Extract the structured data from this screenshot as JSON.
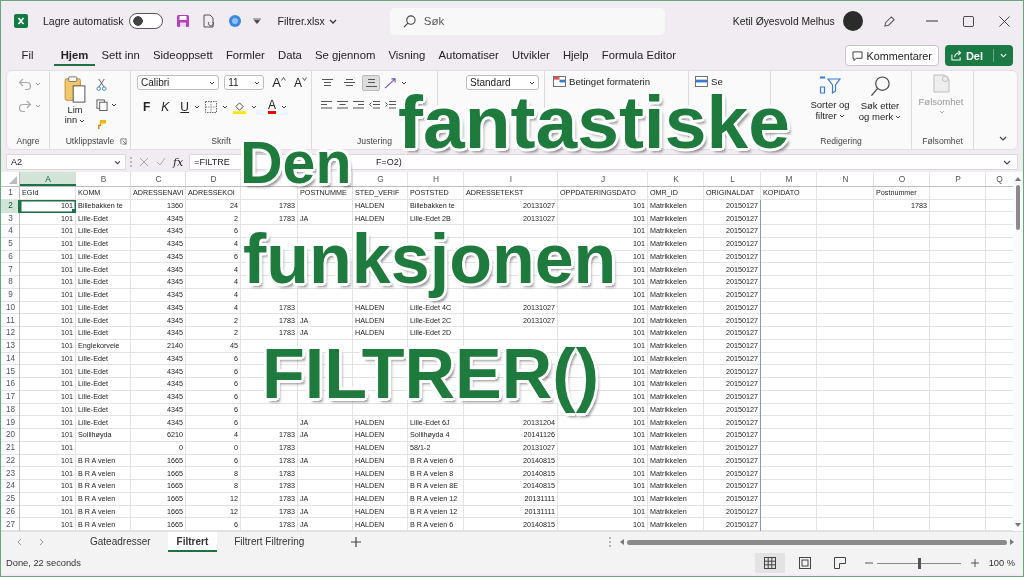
{
  "title_bar": {
    "autosave": {
      "label": "Lagre automatisk",
      "on": false
    },
    "file_name": "Filtrer.xlsx",
    "search": {
      "placeholder": "Søk"
    },
    "user_name": "Ketil Øyesvold Melhus"
  },
  "menu_tabs": [
    {
      "label": "Fil",
      "selected": false
    },
    {
      "label": "Hjem",
      "selected": true
    },
    {
      "label": "Sett inn",
      "selected": false
    },
    {
      "label": "Sideoppsett",
      "selected": false
    },
    {
      "label": "Formler",
      "selected": false
    },
    {
      "label": "Data",
      "selected": false
    },
    {
      "label": "Se gjennom",
      "selected": false
    },
    {
      "label": "Visning",
      "selected": false
    },
    {
      "label": "Automatiser",
      "selected": false
    },
    {
      "label": "Utvikler",
      "selected": false
    },
    {
      "label": "Hjelp",
      "selected": false
    },
    {
      "label": "Formula Editor",
      "selected": false
    }
  ],
  "header_buttons": {
    "comments": "Kommentarer",
    "share": "Del"
  },
  "ribbon": {
    "history": {
      "label": "Angre",
      "undo_disabled": true,
      "redo_disabled": true
    },
    "clipboard": {
      "label": "Utklippstavle",
      "paste": "Lim inn"
    },
    "font": {
      "label": "Skrift",
      "font_name": "Calibri",
      "font_size": "11",
      "grow": "A",
      "shrink": "A",
      "bold": "F",
      "italic": "K",
      "underline": "U",
      "font_color": "A"
    },
    "alignment": {
      "label": "Justering",
      "vertical": [
        {
          "kind": "top",
          "selected": false
        },
        {
          "kind": "middle",
          "selected": false
        },
        {
          "kind": "bottom",
          "selected": true
        }
      ]
    },
    "number": {
      "format": "Standard"
    },
    "styles": {
      "conditional": "Betinget formaterin"
    },
    "cells": {
      "insert": "Se"
    },
    "editing": {
      "label": "Redigering",
      "sort": "Sorter og filtrer",
      "find": "Søk etter og merk"
    },
    "sensitivity": {
      "label": "Følsomhet",
      "button": "Følsomhet",
      "disabled": true
    }
  },
  "formula_bar": {
    "name_box": "A2",
    "fx": "fx",
    "formula_parts": [
      "=FILTRE",
      "F=O2)"
    ]
  },
  "sheet": {
    "columns": [
      {
        "letter": "A",
        "selected": true
      },
      {
        "letter": "B",
        "selected": false
      },
      {
        "letter": "C",
        "selected": false
      },
      {
        "letter": "D",
        "selected": false
      },
      null,
      null,
      {
        "letter": "G",
        "selected": false
      },
      {
        "letter": "H",
        "selected": false
      },
      {
        "letter": "I",
        "selected": false
      },
      {
        "letter": "J",
        "selected": false
      },
      {
        "letter": "K",
        "selected": false
      },
      {
        "letter": "L",
        "selected": false
      },
      {
        "letter": "M",
        "selected": false
      },
      {
        "letter": "N",
        "selected": false
      },
      {
        "letter": "O",
        "selected": false
      },
      {
        "letter": "P",
        "selected": false
      },
      {
        "letter": "Q",
        "selected": false
      }
    ],
    "rows": [
      {
        "number": "1",
        "selected": false,
        "cells": {
          "A": "EGId",
          "B": "KOMM",
          "C": "ADRESSENAVI",
          "D": "ADRESSEKOI",
          "F": "POSTNUMME",
          "G": "STED_VERIF",
          "H": "POSTSTED",
          "I": "ADRESSETEKST",
          "J": "OPPDATERINGSDATO",
          "K": "OMR_ID",
          "L": "ORIGINALDAT",
          "M": "KOPIDATO",
          "O": "Postnummer"
        }
      },
      {
        "number": "2",
        "selected": true,
        "cells": {
          "A": "101",
          "B": "Billebakken te",
          "C": "1360",
          "D": "24",
          "E": "1783",
          "G": "HALDEN",
          "H": "Billebakken te",
          "I": "20131027",
          "J": "101",
          "K": "Matrikkelen",
          "L": "20150127",
          "O": "1783"
        }
      },
      {
        "number": "3",
        "selected": false,
        "cells": {
          "A": "101",
          "B": "Lille-Edet",
          "C": "4345",
          "D": "2",
          "E": "1783",
          "F": "JA",
          "G": "HALDEN",
          "H": "Lille-Edet 2B",
          "I": "20131027",
          "J": "101",
          "K": "Matrikkelen",
          "L": "20150127"
        }
      },
      {
        "number": "4",
        "selected": false,
        "cells": {
          "A": "101",
          "B": "Lille-Edet",
          "C": "4345",
          "D": "6",
          "J": "101",
          "K": "Matrikkelen",
          "L": "20150127"
        }
      },
      {
        "number": "5",
        "selected": false,
        "cells": {
          "A": "101",
          "B": "Lille-Edet",
          "C": "4345",
          "D": "4",
          "J": "101",
          "K": "Matrikkelen",
          "L": "20150127"
        }
      },
      {
        "number": "6",
        "selected": false,
        "cells": {
          "A": "101",
          "B": "Lille-Edet",
          "C": "4345",
          "D": "6",
          "J": "101",
          "K": "Matrikkelen",
          "L": "20150127"
        }
      },
      {
        "number": "7",
        "selected": false,
        "cells": {
          "A": "101",
          "B": "Lille-Edet",
          "C": "4345",
          "D": "4",
          "J": "101",
          "K": "Matrikkelen",
          "L": "20150127"
        }
      },
      {
        "number": "8",
        "selected": false,
        "cells": {
          "A": "101",
          "B": "Lille-Edet",
          "C": "4345",
          "D": "4",
          "J": "101",
          "K": "Matrikkelen",
          "L": "20150127"
        }
      },
      {
        "number": "9",
        "selected": false,
        "cells": {
          "A": "101",
          "B": "Lille-Edet",
          "C": "4345",
          "D": "4",
          "J": "101",
          "K": "Matrikkelen",
          "L": "20150127"
        }
      },
      {
        "number": "10",
        "selected": false,
        "cells": {
          "A": "101",
          "B": "Lille-Edet",
          "C": "4345",
          "D": "4",
          "E": "1783",
          "G": "HALDEN",
          "H": "Lille-Edet 4C",
          "I": "20131027",
          "J": "101",
          "K": "Matrikkelen",
          "L": "20150127"
        }
      },
      {
        "number": "11",
        "selected": false,
        "cells": {
          "A": "101",
          "B": "Lille-Edet",
          "C": "4345",
          "D": "2",
          "E": "1783",
          "F": "JA",
          "G": "HALDEN",
          "H": "Lille-Edet 2C",
          "I": "20131027",
          "J": "101",
          "K": "Matrikkelen",
          "L": "20150127"
        }
      },
      {
        "number": "12",
        "selected": false,
        "cells": {
          "A": "101",
          "B": "Lille-Edet",
          "C": "4345",
          "D": "2",
          "E": "1783",
          "F": "JA",
          "G": "HALDEN",
          "H": "Lille-Edet 2D",
          "J": "101",
          "K": "Matrikkelen",
          "L": "20150127"
        }
      },
      {
        "number": "13",
        "selected": false,
        "cells": {
          "A": "101",
          "B": "Englekorveie",
          "C": "2140",
          "D": "45",
          "J": "101",
          "K": "Matrikkelen",
          "L": "20150127"
        }
      },
      {
        "number": "14",
        "selected": false,
        "cells": {
          "A": "101",
          "B": "Lille-Edet",
          "C": "4345",
          "D": "6",
          "J": "101",
          "K": "Matrikkelen",
          "L": "20150127"
        }
      },
      {
        "number": "15",
        "selected": false,
        "cells": {
          "A": "101",
          "B": "Lille-Edet",
          "C": "4345",
          "D": "6",
          "J": "101",
          "K": "Matrikkelen",
          "L": "20150127"
        }
      },
      {
        "number": "16",
        "selected": false,
        "cells": {
          "A": "101",
          "B": "Lille-Edet",
          "C": "4345",
          "D": "6",
          "J": "101",
          "K": "Matrikkelen",
          "L": "20150127"
        }
      },
      {
        "number": "17",
        "selected": false,
        "cells": {
          "A": "101",
          "B": "Lille-Edet",
          "C": "4345",
          "D": "6",
          "J": "101",
          "K": "Matrikkelen",
          "L": "20150127"
        }
      },
      {
        "number": "18",
        "selected": false,
        "cells": {
          "A": "101",
          "B": "Lille-Edet",
          "C": "4345",
          "D": "6",
          "J": "101",
          "K": "Matrikkelen",
          "L": "20150127"
        }
      },
      {
        "number": "19",
        "selected": false,
        "cells": {
          "A": "101",
          "B": "Lille-Edet",
          "C": "4345",
          "D": "6",
          "F": "JA",
          "G": "HALDEN",
          "H": "Lille-Edet 6J",
          "I": "20131204",
          "J": "101",
          "K": "Matrikkelen",
          "L": "20150127"
        }
      },
      {
        "number": "20",
        "selected": false,
        "cells": {
          "A": "101",
          "B": "Sollihøyda",
          "C": "6210",
          "D": "4",
          "E": "1783",
          "F": "JA",
          "G": "HALDEN",
          "H": "Sollihøyda 4",
          "I": "20141126",
          "J": "101",
          "K": "Matrikkelen",
          "L": "20150127"
        }
      },
      {
        "number": "21",
        "selected": false,
        "cells": {
          "A": "101",
          "C": "0",
          "D": "0",
          "E": "1783",
          "G": "HALDEN",
          "H": "58/1-2",
          "I": "20131027",
          "J": "101",
          "K": "Matrikkelen",
          "L": "20150127"
        }
      },
      {
        "number": "22",
        "selected": false,
        "cells": {
          "A": "101",
          "B": "B R A veien",
          "C": "1665",
          "D": "6",
          "E": "1783",
          "F": "JA",
          "G": "HALDEN",
          "H": "B R A veien 6",
          "I": "20140815",
          "J": "101",
          "K": "Matrikkelen",
          "L": "20150127"
        }
      },
      {
        "number": "23",
        "selected": false,
        "cells": {
          "A": "101",
          "B": "B R A veien",
          "C": "1665",
          "D": "8",
          "E": "1783",
          "G": "HALDEN",
          "H": "B R A veien 8",
          "I": "20140815",
          "J": "101",
          "K": "Matrikkelen",
          "L": "20150127"
        }
      },
      {
        "number": "24",
        "selected": false,
        "cells": {
          "A": "101",
          "B": "B R A veien",
          "C": "1665",
          "D": "8",
          "E": "1783",
          "G": "HALDEN",
          "H": "B R A veien 8E",
          "I": "20140815",
          "J": "101",
          "K": "Matrikkelen",
          "L": "20150127"
        }
      },
      {
        "number": "25",
        "selected": false,
        "cells": {
          "A": "101",
          "B": "B R A veien",
          "C": "1665",
          "D": "12",
          "E": "1783",
          "F": "JA",
          "G": "HALDEN",
          "H": "B R A veien 12",
          "I": "20131111",
          "J": "101",
          "K": "Matrikkelen",
          "L": "20150127"
        }
      },
      {
        "number": "26",
        "selected": false,
        "cells": {
          "A": "101",
          "B": "B R A veien",
          "C": "1665",
          "D": "12",
          "E": "1783",
          "F": "JA",
          "G": "HALDEN",
          "H": "B R A veien 12",
          "I": "20131111",
          "J": "101",
          "K": "Matrikkelen",
          "L": "20150127"
        }
      },
      {
        "number": "27",
        "selected": false,
        "cells": {
          "A": "101",
          "B": "B R A veien",
          "C": "1665",
          "D": "6",
          "E": "1783",
          "F": "JA",
          "G": "HALDEN",
          "H": "B R A veien 6",
          "I": "20140815",
          "J": "101",
          "K": "Matrikkelen",
          "L": "20150127"
        }
      }
    ]
  },
  "sheet_tabs": [
    {
      "label": "Gateadresser",
      "selected": false
    },
    {
      "label": "Filtrert",
      "selected": true
    },
    {
      "label": "Filtrert Filtrering",
      "selected": false
    }
  ],
  "status_bar": {
    "message": "Done, 22 seconds",
    "views": [
      {
        "kind": "normal",
        "selected": true
      },
      {
        "kind": "page-layout",
        "selected": false
      },
      {
        "kind": "page-break",
        "selected": false
      }
    ],
    "zoom": {
      "level": 0.5,
      "reading": "100 %"
    }
  },
  "overlay_title": [
    "Den",
    "fantastiske",
    "funksjonen",
    "FILTRER()"
  ]
}
